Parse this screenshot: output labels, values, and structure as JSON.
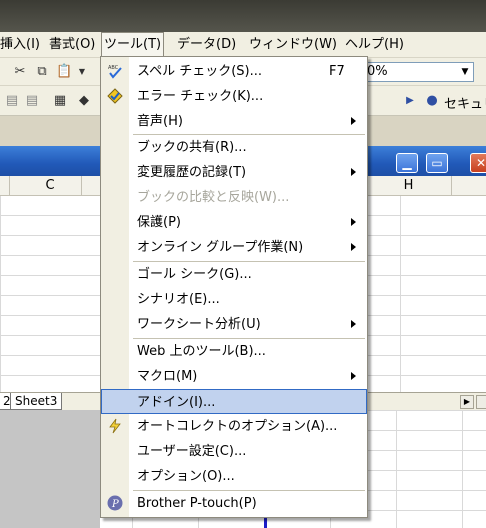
{
  "menubar": {
    "items": [
      "挿入(I)",
      "書式(O)",
      "ツール(T)",
      "データ(D)",
      "ウィンドウ(W)",
      "ヘルプ(H)"
    ]
  },
  "toolbar": {
    "zoom_value": "0%",
    "security_label": "セキュリ"
  },
  "spreadsheet": {
    "columns": [
      "C",
      "H"
    ],
    "sheet_tab": "Sheet3"
  },
  "tools_menu": {
    "items": [
      {
        "label": "スペル チェック(S)...",
        "shortcut": "F7",
        "icon": "spell-check-icon"
      },
      {
        "label": "エラー チェック(K)...",
        "icon": "error-check-icon"
      },
      {
        "label": "音声(H)",
        "submenu": true
      },
      {
        "label": "ブックの共有(R)..."
      },
      {
        "label": "変更履歴の記録(T)",
        "submenu": true
      },
      {
        "label": "ブックの比較と反映(W)...",
        "disabled": true
      },
      {
        "label": "保護(P)",
        "submenu": true
      },
      {
        "label": "オンライン グループ作業(N)",
        "submenu": true
      },
      {
        "label": "ゴール シーク(G)..."
      },
      {
        "label": "シナリオ(E)..."
      },
      {
        "label": "ワークシート分析(U)",
        "submenu": true
      },
      {
        "label": "Web 上のツール(B)..."
      },
      {
        "label": "マクロ(M)",
        "submenu": true
      },
      {
        "label": "アドイン(I)...",
        "highlighted": true
      },
      {
        "label": "オートコレクトのオプション(A)...",
        "icon": "autocorrect-icon"
      },
      {
        "label": "ユーザー設定(C)..."
      },
      {
        "label": "オプション(O)..."
      },
      {
        "label": "Brother P-touch(P)",
        "icon": "brother-ptouch-icon"
      }
    ]
  },
  "colors": {
    "menu_bg": "#f1efe2",
    "highlight": "#c1d2ee",
    "highlight_border": "#316ac5",
    "title_blue": "#2159b8"
  }
}
